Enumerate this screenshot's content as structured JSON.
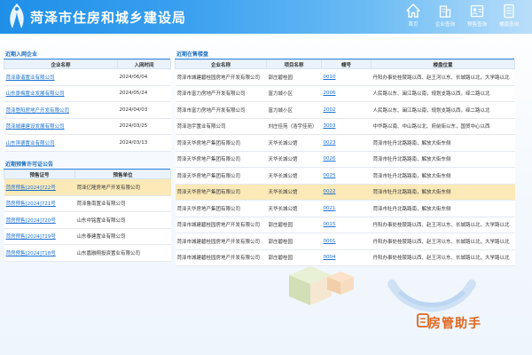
{
  "header": {
    "title": "菏泽市住房和城乡建设局",
    "nav": [
      {
        "label": "首页",
        "icon": "home-icon"
      },
      {
        "label": "企业查询",
        "icon": "building-icon"
      },
      {
        "label": "预售查询",
        "icon": "presale-icon"
      },
      {
        "label": "楼盘查询",
        "icon": "document-icon"
      }
    ]
  },
  "recent_companies": {
    "title": "近期入网企业",
    "headers": [
      "企业名称",
      "入网时间"
    ],
    "rows": [
      [
        "菏泽康谐置业有限公司",
        "2024/06/04"
      ],
      [
        "山东景梅置业发展有限公司",
        "2024/05/24"
      ],
      [
        "菏泽登阳房地产开发有限公司",
        "2024/04/03"
      ],
      [
        "菏泽城建建设发展有限公司",
        "2024/03/25"
      ],
      [
        "山东滨德置业有限公司",
        "2024/03/13"
      ]
    ]
  },
  "presale": {
    "title": "近期预售许可证公告",
    "headers": [
      "预售证号",
      "预售单位"
    ],
    "rows": [
      [
        "菏房预售[2024]722号",
        "菏泽亿隆房地产开发有限公司"
      ],
      [
        "菏房预售[2024]721号",
        "菏泽鲁南置业有限公司"
      ],
      [
        "菏房预售[2024]720号",
        "山东中铭置业有限公司"
      ],
      [
        "菏房预售[2024]719号",
        "山东泰建置业有限公司"
      ],
      [
        "菏房预售[2024]718号",
        "山东嘉融翔投资置业有限公司"
      ]
    ]
  },
  "on_sale": {
    "title": "近期在售楼盘",
    "headers": [
      "企业名称",
      "项目名称",
      "幢号",
      "楼盘位置"
    ],
    "rows": [
      [
        "菏泽市城建碧桂园房地产开发有限公司",
        "郭庄碧桂园",
        "0010",
        "丹阳办事处桂陵路以西、赵王河以东、长城路以北，大学路以北"
      ],
      [
        "菏泽市富力房地产开发有限公司",
        "富力城小区",
        "2006",
        "人民路以东、闽江路以南，规划支路以西，绎二路以北"
      ],
      [
        "菏泽市富力房地产开发有限公司",
        "富力城小区",
        "2002",
        "人民路以东、闽江路以南，规划支路以西，绎二路以北"
      ],
      [
        "菏泽浩宇置业有限公司",
        "刘庄佳苑（浩宇佳苑）",
        "3003",
        "中华路以南、中山路以北、府前街以东，国贸中心以西"
      ],
      [
        "菏泽天华房地产集团有限公司",
        "天华长城公馆",
        "0023",
        "菏泽市牡丹北路路南，解放大街东侧"
      ],
      [
        "菏泽天华房地产集团有限公司",
        "天华长城公馆",
        "0026",
        "菏泽市牡丹北路路南，解放大街东侧"
      ],
      [
        "菏泽天华房地产集团有限公司",
        "天华长城公馆",
        "0025",
        "菏泽市牡丹北路路南，解放大街东侧"
      ],
      [
        "菏泽天华房地产集团有限公司",
        "天华长城公馆",
        "0022",
        "菏泽市牡丹北路路南，解放大街东侧"
      ],
      [
        "菏泽天华房地产集团有限公司",
        "天华长城公馆",
        "0021",
        "菏泽市牡丹北路路南，解放大街东侧"
      ],
      [
        "菏泽市城建碧桂园房地产开发有限公司",
        "郭庄碧桂园",
        "0015",
        "丹阳办事处桂陵路以西、赵王河以东、长城路以北，大学路以北"
      ],
      [
        "菏泽市城建碧桂园房地产开发有限公司",
        "郭庄碧桂园",
        "0001",
        "丹阳办事处桂陵路以西、赵王河以东、长城路以北，大学路以北"
      ],
      [
        "菏泽市城建碧桂园房地产开发有限公司",
        "郭庄碧桂园",
        "0004",
        "丹阳办事处桂陵路以西、赵王河以东、长城路以北，大学路以北"
      ]
    ]
  },
  "helper": {
    "label": "房管助手"
  },
  "colors": {
    "accent": "#2e86de",
    "highlight": "#fbe9b7",
    "link": "#1a6fd0",
    "helper": "#e0651b"
  }
}
